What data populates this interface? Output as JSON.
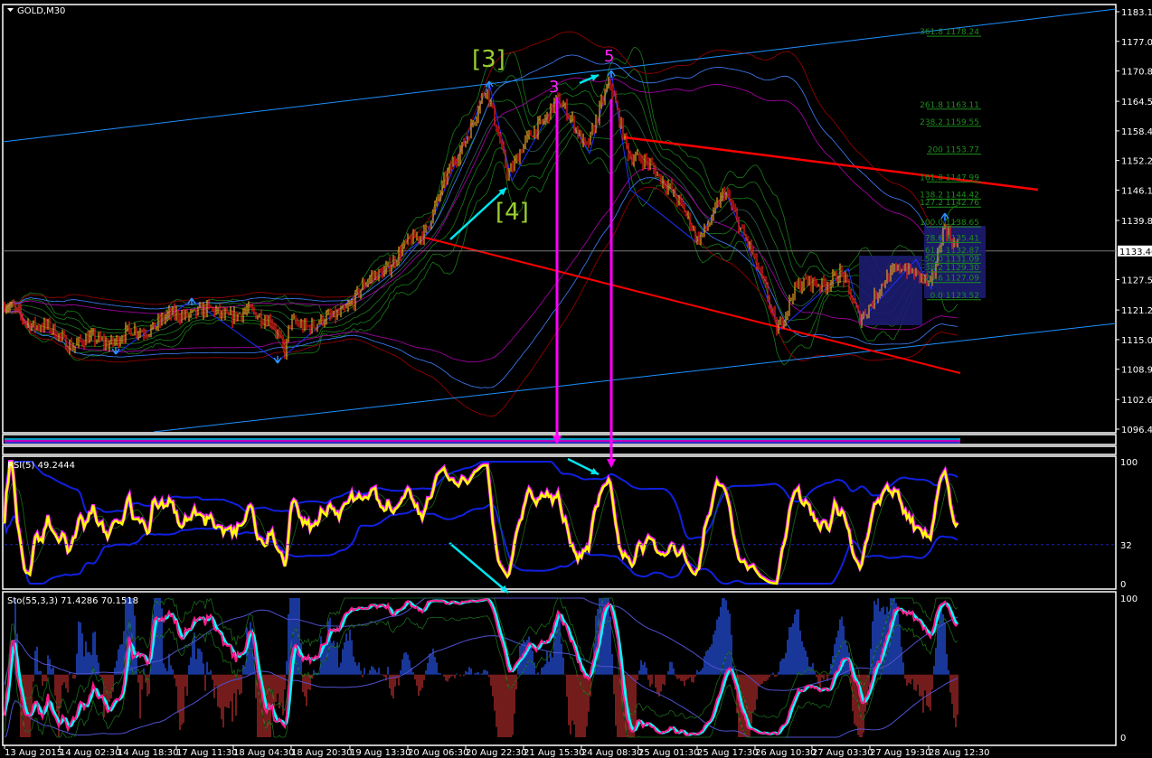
{
  "window": {
    "title": "GOLD,M30",
    "menu_icon": "triangle-down-icon"
  },
  "chart_data": {
    "type": "candlestick",
    "symbol": "GOLD",
    "timeframe": "M30",
    "price_axis": {
      "ticks": [
        "1183.15",
        "1177.00",
        "1170.85",
        "1164.55",
        "1158.40",
        "1152.25",
        "1146.10",
        "1139.80",
        "1127.50",
        "1121.20",
        "1115.05",
        "1108.90",
        "1102.60",
        "1096.45"
      ],
      "range": [
        1096.45,
        1183.15
      ],
      "current_price": "1133.46"
    },
    "time_axis": {
      "ticks": [
        "13 Aug 2015",
        "14 Aug 02:30",
        "14 Aug 18:30",
        "17 Aug 11:30",
        "18 Aug 04:30",
        "18 Aug 20:30",
        "19 Aug 13:30",
        "20 Aug 06:30",
        "20 Aug 22:30",
        "21 Aug 15:30",
        "24 Aug 08:30",
        "25 Aug 01:30",
        "25 Aug 17:30",
        "26 Aug 10:30",
        "27 Aug 03:30",
        "27 Aug 19:30",
        "28 Aug 12:30"
      ]
    },
    "price_path": [
      [
        "13 Aug 11:00",
        1121.8
      ],
      [
        "14 Aug 06:00",
        1114.3
      ],
      [
        "14 Aug 18:30",
        1115.2
      ],
      [
        "17 Aug 15:00",
        1120.9
      ],
      [
        "18 Aug 15:00",
        1119.9
      ],
      [
        "18 Aug 19:00",
        1111.5
      ],
      [
        "18 Aug 20:00",
        1118.0
      ],
      [
        "19 Aug 08:30",
        1119.0
      ],
      [
        "19 Aug 17:00",
        1125.5
      ],
      [
        "20 Aug 11:00",
        1137.7
      ],
      [
        "21 Aug 04:30",
        1166.8
      ],
      [
        "21 Aug 11:00",
        1150.0
      ],
      [
        "24 Aug 01:30",
        1165.0
      ],
      [
        "24 Aug 10:00",
        1155.6
      ],
      [
        "24 Aug 17:00",
        1167.8
      ],
      [
        "24 Aug 23:00",
        1153.7
      ],
      [
        "25 Aug 09:30",
        1148.0
      ],
      [
        "25 Aug 17:30",
        1135.9
      ],
      [
        "26 Aug 01:30",
        1145.0
      ],
      [
        "26 Aug 09:00",
        1135.0
      ],
      [
        "26 Aug 17:00",
        1117.1
      ],
      [
        "26 Aug 22:00",
        1125.5
      ],
      [
        "27 Aug 11:30",
        1128.3
      ],
      [
        "27 Aug 16:30",
        1119.9
      ],
      [
        "28 Aug 05:00",
        1131.2
      ],
      [
        "28 Aug 13:00",
        1125.5
      ],
      [
        "28 Aug 17:00",
        1139.6
      ],
      [
        "28 Aug 20:30",
        1134.0
      ]
    ],
    "colors": {
      "bull_candle": "#f0a020",
      "bear_candle": "#ff1a1a",
      "channel": "#1e90ff",
      "trendline": "#ff0000",
      "vertical_marker": "#ff00ff",
      "arrow": "#00e5ee",
      "wave_major": "#9acd32",
      "wave_minor": "#ff20ff",
      "fib": "#1e8c1e",
      "box": "#1c1c70"
    },
    "elliott_labels": {
      "w3_major": "[3]",
      "w4_major": "[4]",
      "w3_minor": "3",
      "w5_minor": "5"
    },
    "fib_levels": [
      {
        "ratio": "361.8",
        "price": "1178.24"
      },
      {
        "ratio": "261.8",
        "price": "1163.11"
      },
      {
        "ratio": "238.2",
        "price": "1159.55"
      },
      {
        "ratio": "200",
        "price": "1153.77"
      },
      {
        "ratio": "161.8",
        "price": "1147.99"
      },
      {
        "ratio": "138.2",
        "price": "1144.42"
      },
      {
        "ratio": "127.2",
        "price": "1142.76"
      },
      {
        "ratio": "100.0",
        "price": "1138.65"
      },
      {
        "ratio": "78.6",
        "price": "1135.41"
      },
      {
        "ratio": "61.8",
        "price": "1132.87"
      },
      {
        "ratio": "50.0",
        "price": "1131.09"
      },
      {
        "ratio": "38.2",
        "price": "1129.30"
      },
      {
        "ratio": "23.6",
        "price": "1127.09"
      },
      {
        "ratio": "0.0",
        "price": "1123.52"
      }
    ],
    "rsi": {
      "label": "RSI(5) 49.2444",
      "period": 5,
      "levels": [
        "100",
        "32",
        "0"
      ],
      "level_value": 32,
      "range": [
        0,
        100
      ]
    },
    "stochastic": {
      "label": "Sto(55,3,3) 71.4286 70.1518",
      "k": 55,
      "d": 3,
      "slowing": 3,
      "levels": [
        "100",
        "0"
      ],
      "range": [
        0,
        100
      ]
    }
  }
}
